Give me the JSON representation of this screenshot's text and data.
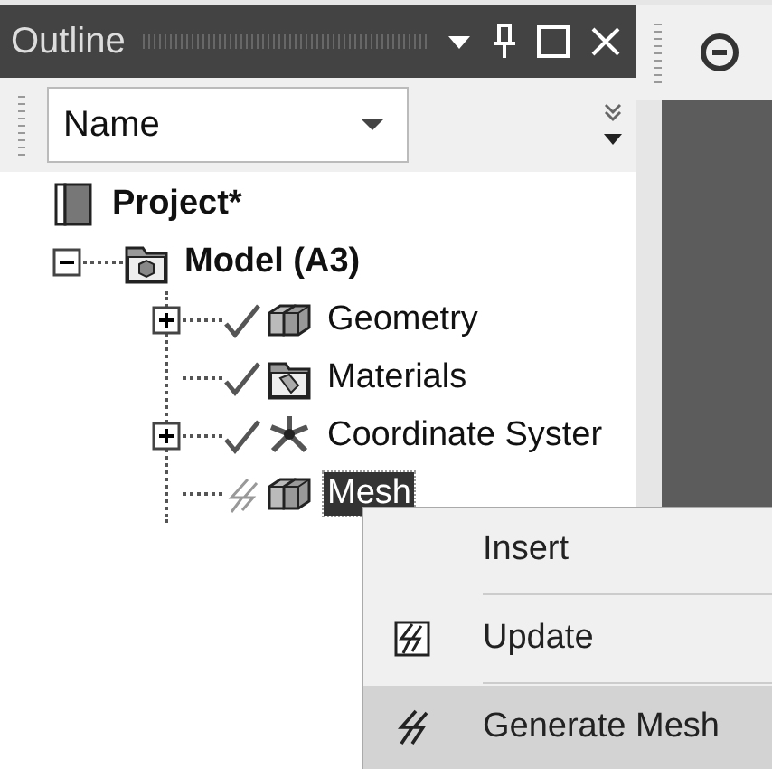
{
  "panel": {
    "title": "Outline"
  },
  "toolbar": {
    "dropdown": {
      "value": "Name"
    }
  },
  "tree": [
    {
      "label": "Project*",
      "bold": true,
      "kind": "project",
      "selected": false,
      "children": [
        {
          "label": "Model (A3)",
          "bold": true,
          "kind": "model",
          "expanded": true,
          "selected": false,
          "children": [
            {
              "label": "Geometry",
              "bold": false,
              "kind": "geometry",
              "expanded": false,
              "done": true,
              "selected": false
            },
            {
              "label": "Materials",
              "bold": false,
              "kind": "materials",
              "done": true,
              "selected": false
            },
            {
              "label": "Coordinate Syster",
              "bold": false,
              "kind": "coordinates",
              "expanded": false,
              "done": true,
              "selected": false
            },
            {
              "label": "Mesh",
              "bold": false,
              "kind": "mesh",
              "done": false,
              "selected": true
            }
          ]
        }
      ]
    }
  ],
  "context_menu": [
    {
      "label": "Insert",
      "kind": "plain",
      "selected": false
    },
    {
      "label": "Update",
      "kind": "update",
      "selected": false
    },
    {
      "label": "Generate Mesh",
      "kind": "generate",
      "selected": true
    }
  ]
}
